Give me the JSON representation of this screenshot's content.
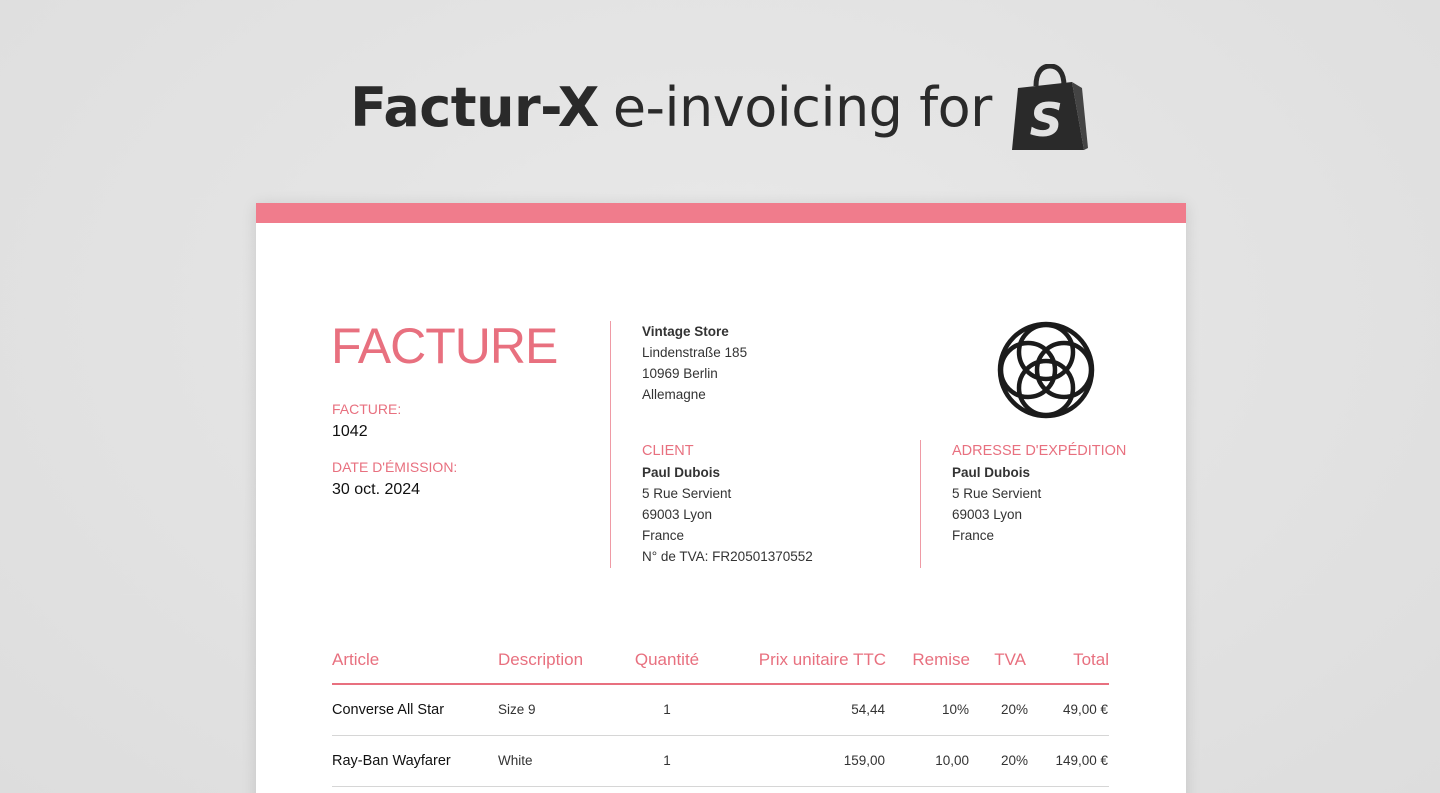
{
  "banner": {
    "bold": "Factur-X",
    "rest": "e-invoicing for",
    "icon": "shopify-bag-icon"
  },
  "colors": {
    "accent": "#e8707f",
    "topbar": "#f07c8c",
    "text": "#111111"
  },
  "invoice": {
    "title": "FACTURE",
    "number_label": "FACTURE:",
    "number": "1042",
    "date_label": "DATE D'ÉMISSION:",
    "date": "30 oct. 2024"
  },
  "seller": {
    "name": "Vintage Store",
    "lines": [
      "Lindenstraße 185",
      "10969 Berlin",
      "Allemagne"
    ]
  },
  "client": {
    "label": "CLIENT",
    "name": "Paul Dubois",
    "lines": [
      "5 Rue Servient",
      "69003 Lyon",
      "France",
      "N° de TVA: FR20501370552"
    ]
  },
  "shipping": {
    "label": "ADRESSE D'EXPÉDITION",
    "name": "Paul Dubois",
    "lines": [
      "5 Rue Servient",
      "69003 Lyon",
      "France"
    ]
  },
  "table": {
    "headers": [
      "Article",
      "Description",
      "Quantité",
      "Prix unitaire TTC",
      "Remise",
      "TVA",
      "Total"
    ],
    "rows": [
      [
        "Converse All Star",
        "Size 9",
        "1",
        "54,44",
        "10%",
        "20%",
        "49,00 €"
      ],
      [
        "Ray-Ban Wayfarer",
        "White",
        "1",
        "159,00",
        "10,00",
        "20%",
        "149,00 €"
      ]
    ]
  }
}
